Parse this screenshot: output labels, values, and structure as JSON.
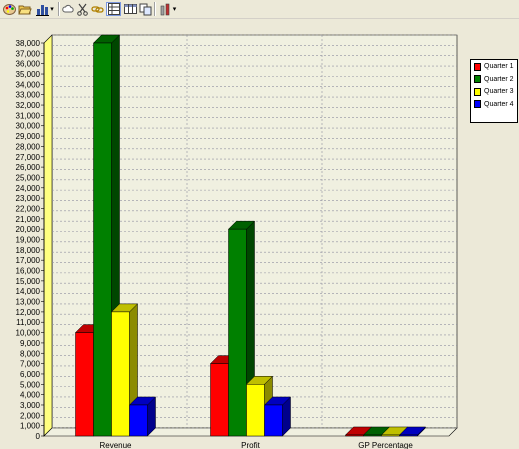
{
  "toolbar": {
    "icons": [
      "palette-icon",
      "open-folder-icon",
      "bar-chart-type-icon",
      "cloud-icon",
      "cut-icon",
      "link-icon",
      "data-grid-icon",
      "table-icon",
      "copy-icon",
      "series-icon"
    ]
  },
  "colors": {
    "quarter1": "#FF0000",
    "quarter2": "#008000",
    "quarter3": "#FFFF00",
    "quarter4": "#0000FF",
    "background": "#ECE9D8",
    "wall": "#F0F0E0"
  },
  "chart_data": {
    "type": "bar",
    "categories": [
      "Revenue",
      "Profit",
      "GP Percentage"
    ],
    "series": [
      {
        "name": "Quarter 1",
        "values": [
          10000,
          7000,
          100
        ]
      },
      {
        "name": "Quarter 2",
        "values": [
          38000,
          20000,
          100
        ]
      },
      {
        "name": "Quarter 3",
        "values": [
          12000,
          5000,
          100
        ]
      },
      {
        "name": "Quarter 4",
        "values": [
          3000,
          3000,
          100
        ]
      }
    ],
    "ylim": [
      0,
      38000
    ],
    "ytick_step": 1000,
    "ytick_labels": [
      "0",
      "1,000",
      "2,000",
      "3,000",
      "4,000",
      "5,000",
      "6,000",
      "7,000",
      "8,000",
      "9,000",
      "10,000",
      "11,000",
      "12,000",
      "13,000",
      "14,000",
      "15,000",
      "16,000",
      "17,000",
      "18,000",
      "19,000",
      "20,000",
      "21,000",
      "22,000",
      "23,000",
      "24,000",
      "25,000",
      "26,000",
      "27,000",
      "28,000",
      "29,000",
      "30,000",
      "31,000",
      "32,000",
      "33,000",
      "34,000",
      "35,000",
      "36,000",
      "37,000",
      "38,000"
    ],
    "grid": true,
    "legend_position": "right",
    "title": "",
    "xlabel": "",
    "ylabel": ""
  }
}
